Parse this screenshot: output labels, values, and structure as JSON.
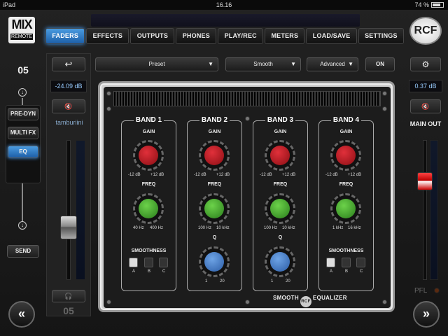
{
  "status": {
    "device": "iPad",
    "time": "16.16",
    "battery": "74 %"
  },
  "logo": {
    "mix": "MIX",
    "remote": "REMOTE",
    "rcf": "RCF"
  },
  "tabs": [
    "FADERS",
    "EFFECTS",
    "OUTPUTS",
    "PHONES",
    "PLAY/REC",
    "METERS",
    "LOAD/SAVE",
    "SETTINGS"
  ],
  "left": {
    "channel": "05",
    "buttons": [
      "PRE-DYN",
      "MULTI FX",
      "EQ"
    ],
    "send": "SEND",
    "nav_prev": "«"
  },
  "strip": {
    "db": "-24.09 dB",
    "name": "tamburiini",
    "num": "05",
    "mute_icon": "🔇",
    "back_icon": "↩"
  },
  "controls": {
    "preset": "Preset",
    "smooth": "Smooth",
    "advanced": "Advanced",
    "on": "ON",
    "arrow": "▼"
  },
  "eq": {
    "logo_left": "SMOOTH",
    "logo_rcf": "RCF",
    "logo_right": "EQUALIZER",
    "bands": [
      {
        "title": "BAND 1",
        "gain": "GAIN",
        "g_lo": "-12 dB",
        "g_hi": "+12 dB",
        "freq": "FREQ",
        "f_lo": "40 Hz",
        "f_hi": "400 Hz",
        "bottom": "SMOOTHNESS",
        "opts": [
          "A",
          "B",
          "C"
        ]
      },
      {
        "title": "BAND 2",
        "gain": "GAIN",
        "g_lo": "-12 dB",
        "g_hi": "+12 dB",
        "freq": "FREQ",
        "f_lo": "100 Hz",
        "f_hi": "10 kHz",
        "bottom": "Q",
        "q_lo": "1",
        "q_hi": "20"
      },
      {
        "title": "BAND 3",
        "gain": "GAIN",
        "g_lo": "-12 dB",
        "g_hi": "+12 dB",
        "freq": "FREQ",
        "f_lo": "100 Hz",
        "f_hi": "10 kHz",
        "bottom": "Q",
        "q_lo": "1",
        "q_hi": "20"
      },
      {
        "title": "BAND 4",
        "gain": "GAIN",
        "g_lo": "-12 dB",
        "g_hi": "+12 dB",
        "freq": "FREQ",
        "f_lo": "1 kHz",
        "f_hi": "16 kHz",
        "bottom": "SMOOTHNESS",
        "opts": [
          "A",
          "B",
          "C"
        ]
      }
    ]
  },
  "right": {
    "gear_icon": "⚙",
    "db": "0.37 dB",
    "mute_icon": "🔇",
    "main_out": "MAIN OUT",
    "pfl": "PFL",
    "nav_next": "»"
  },
  "colors": {
    "accent": "#2a7fd4",
    "gain_knob": "#c0202a",
    "freq_knob": "#4aa52e",
    "q_knob": "#4a80c8"
  }
}
